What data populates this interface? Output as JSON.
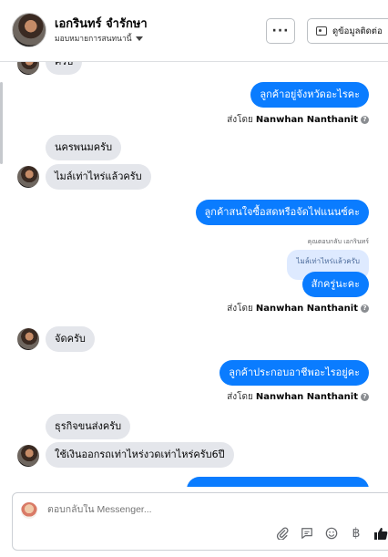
{
  "header": {
    "contact_name": "เอกรินทร์ จำรักษา",
    "assignment_label": "มอบหมายการสนทนานี้",
    "more_label": "···",
    "view_contact_label": "ดูข้อมูลติดต่อ"
  },
  "messages": {
    "top_partial": "ครับ",
    "m1": "ลูกค้าอยู่จังหวัดอะไรคะ",
    "sender_prefix": "ส่งโดย",
    "sender_name": "Nanwhan Nanthanit",
    "m2": "นครพนมครับ",
    "m3": "ไมล์เท่าไหร่แล้วครับ",
    "m4": "ลูกค้าสนใจซื้อสดหรือจัดไฟแนนซ์คะ",
    "reply_note": "คุณตอบกลับ เอกรินทร์",
    "reply_quote": "ไมล์เท่าไหร่แล้วครับ",
    "m5": "สักครู่นะคะ",
    "m6": "จัดครับ",
    "m7": "ลูกค้าประกอบอาชีพอะไรอยู่คะ",
    "m8": "ธุรกิจขนส่งครับ",
    "m9": "ใช้เงินออกรถเท่าไหร่งวดเท่าไหร่ครับ6ปี"
  },
  "composer": {
    "placeholder": "ตอบกลับใน Messenger...",
    "currency_symbol": "฿"
  },
  "colors": {
    "outgoing_bubble": "#0a7cff",
    "incoming_bubble": "#e4e6eb",
    "like_icon": "#1c1e21"
  }
}
